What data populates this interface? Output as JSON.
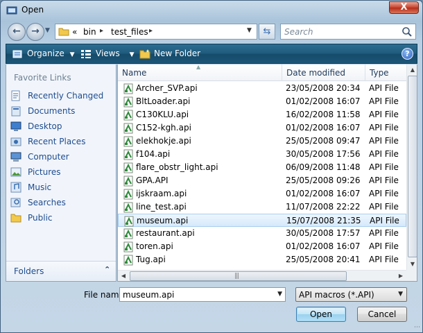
{
  "window": {
    "title": "Open",
    "close_label": "X"
  },
  "navigation": {
    "back_icon": "back-arrow-icon",
    "forward_icon": "forward-arrow-icon"
  },
  "address_bar": {
    "overflow": "«",
    "segments": [
      "bin",
      "test_files"
    ]
  },
  "search": {
    "placeholder": "Search"
  },
  "toolbar": {
    "organize_label": "Organize",
    "views_label": "Views",
    "new_folder_label": "New Folder",
    "help_label": "?"
  },
  "favorites": {
    "title": "Favorite Links",
    "items": [
      {
        "label": "Recently Changed",
        "icon": "recent-changes-icon"
      },
      {
        "label": "Documents",
        "icon": "documents-icon"
      },
      {
        "label": "Desktop",
        "icon": "desktop-icon"
      },
      {
        "label": "Recent Places",
        "icon": "recent-places-icon"
      },
      {
        "label": "Computer",
        "icon": "computer-icon"
      },
      {
        "label": "Pictures",
        "icon": "pictures-icon"
      },
      {
        "label": "Music",
        "icon": "music-icon"
      },
      {
        "label": "Searches",
        "icon": "searches-icon"
      },
      {
        "label": "Public",
        "icon": "public-folder-icon"
      }
    ],
    "folders_label": "Folders"
  },
  "file_list": {
    "columns": [
      "Name",
      "Date modified",
      "Type"
    ],
    "files": [
      {
        "name": "Archer_SVP.api",
        "date": "23/05/2008 20:34",
        "type": "API File"
      },
      {
        "name": "BltLoader.api",
        "date": "01/02/2008 16:07",
        "type": "API File"
      },
      {
        "name": "C130KLU.api",
        "date": "16/02/2008 11:58",
        "type": "API File"
      },
      {
        "name": "C152-kgh.api",
        "date": "01/02/2008 16:07",
        "type": "API File"
      },
      {
        "name": "elekhokje.api",
        "date": "25/05/2008 09:47",
        "type": "API File"
      },
      {
        "name": "f104.api",
        "date": "30/05/2008 17:56",
        "type": "API File"
      },
      {
        "name": "flare_obstr_light.api",
        "date": "06/09/2008 11:48",
        "type": "API File"
      },
      {
        "name": "GPA.API",
        "date": "25/05/2008 09:26",
        "type": "API File"
      },
      {
        "name": "ijskraam.api",
        "date": "01/02/2008 16:07",
        "type": "API File"
      },
      {
        "name": "line_test.api",
        "date": "11/07/2008 22:22",
        "type": "API File"
      },
      {
        "name": "museum.api",
        "date": "15/07/2008 21:35",
        "type": "API File",
        "selected": true
      },
      {
        "name": "restaurant.api",
        "date": "30/05/2008 17:57",
        "type": "API File"
      },
      {
        "name": "toren.api",
        "date": "01/02/2008 16:07",
        "type": "API File"
      },
      {
        "name": "Tug.api",
        "date": "25/05/2008 20:41",
        "type": "API File"
      }
    ]
  },
  "footer": {
    "file_name_label": "File name:",
    "file_name_value": "museum.api",
    "filter_value": "API macros (*.API)",
    "open_label": "Open",
    "cancel_label": "Cancel"
  },
  "colors": {
    "toolbar": "#1f5a7c",
    "selection": "#d6e9fb",
    "link_text": "#1e4c8f",
    "close_button": "#c8402a"
  }
}
